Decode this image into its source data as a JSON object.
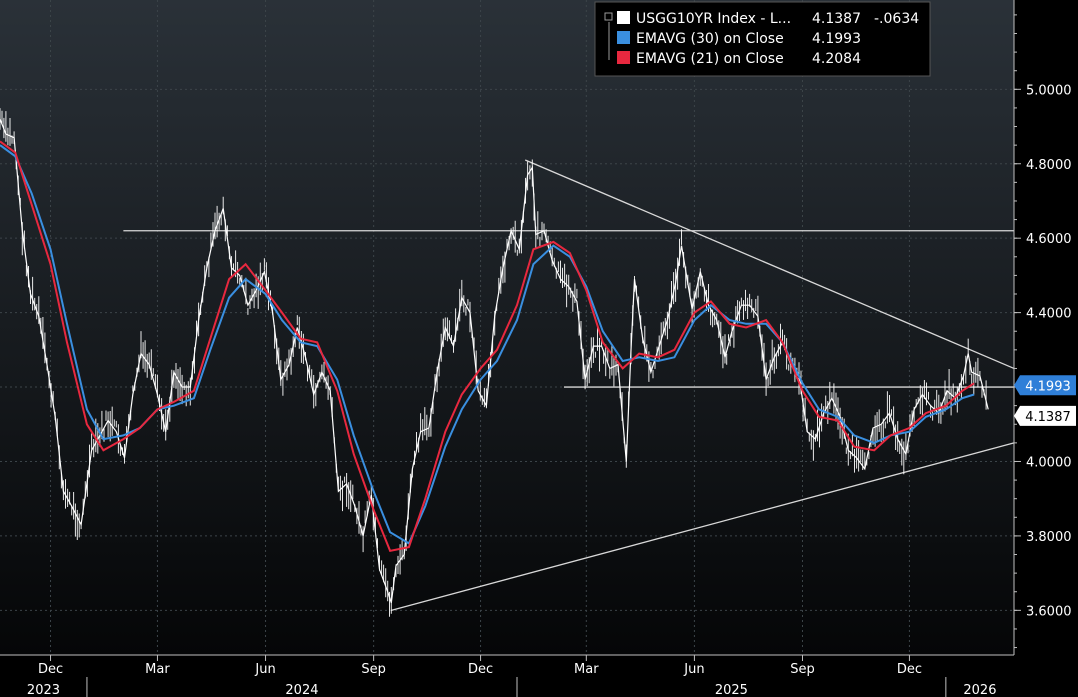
{
  "colors": {
    "background": "#000000",
    "gradient_top": "#2a3138",
    "gradient_bottom": "#050607",
    "price": "#ffffff",
    "ema30": "#3a8fe0",
    "ema21": "#e8283f",
    "trendline": "#d8d8d8",
    "axis": "#bfbfbf"
  },
  "legend": {
    "items": [
      {
        "label": "USGG10YR Index - L...",
        "value": "4.1387",
        "change": "-.0634",
        "color": "#ffffff",
        "icon": "white-square-icon"
      },
      {
        "label": "EMAVG (30)  on Close",
        "value": "4.1993",
        "change": "",
        "color": "#3a8fe0",
        "icon": "blue-square-icon"
      },
      {
        "label": "EMAVG (21)  on Close",
        "value": "4.2084",
        "change": "",
        "color": "#e8283f",
        "icon": "red-square-icon"
      }
    ]
  },
  "last_value_tags": [
    {
      "text": "4.1993",
      "value": 4.1993,
      "bg": "#2f7fd8",
      "fg": "#ffffff"
    },
    {
      "text": "4.1387",
      "value": 4.1387,
      "bg": "#ffffff",
      "fg": "#000000"
    }
  ],
  "chart_data": {
    "type": "line",
    "title": "",
    "xlabel": "",
    "ylabel": "",
    "x_range": [
      "2023-10-19",
      "2026-02-28"
    ],
    "ylim": [
      3.48,
      5.24
    ],
    "grid": true,
    "legend_position": "top-right",
    "y_ticks": [
      {
        "value": 3.6,
        "label": "3.6000"
      },
      {
        "value": 3.8,
        "label": "3.8000"
      },
      {
        "value": 4.0,
        "label": "4.0000"
      },
      {
        "value": 4.2,
        "label": "4.2000"
      },
      {
        "value": 4.4,
        "label": "4.4000"
      },
      {
        "value": 4.6,
        "label": "4.6000"
      },
      {
        "value": 4.8,
        "label": "4.8000"
      },
      {
        "value": 5.0,
        "label": "5.0000"
      }
    ],
    "x_ticks": [
      {
        "date": "2023-12-01",
        "label": "Dec"
      },
      {
        "date": "2024-03-01",
        "label": "Mar"
      },
      {
        "date": "2024-06-01",
        "label": "Jun"
      },
      {
        "date": "2024-09-01",
        "label": "Sep"
      },
      {
        "date": "2024-12-01",
        "label": "Dec"
      },
      {
        "date": "2025-03-01",
        "label": "Mar"
      },
      {
        "date": "2025-06-01",
        "label": "Jun"
      },
      {
        "date": "2025-09-01",
        "label": "Sep"
      },
      {
        "date": "2025-12-01",
        "label": "Dec"
      }
    ],
    "years": [
      {
        "label": "2023",
        "start": "2023-10-19",
        "end": "2024-01-01"
      },
      {
        "label": "2024",
        "start": "2024-01-01",
        "end": "2025-01-01"
      },
      {
        "label": "2025",
        "start": "2025-01-01",
        "end": "2026-01-01"
      },
      {
        "label": "2026",
        "start": "2026-01-01",
        "end": "2026-02-28"
      }
    ],
    "series": [
      {
        "name": "USGG10YR Index - L...",
        "color": "#ffffff",
        "x": [
          "2023-10-19",
          "2023-10-24",
          "2023-10-31",
          "2023-11-07",
          "2023-11-14",
          "2023-11-21",
          "2023-11-28",
          "2023-12-05",
          "2023-12-12",
          "2023-12-19",
          "2023-12-27",
          "2024-01-05",
          "2024-01-12",
          "2024-01-19",
          "2024-01-26",
          "2024-02-02",
          "2024-02-09",
          "2024-02-16",
          "2024-02-23",
          "2024-03-01",
          "2024-03-08",
          "2024-03-15",
          "2024-03-22",
          "2024-03-29",
          "2024-04-05",
          "2024-04-12",
          "2024-04-19",
          "2024-04-26",
          "2024-05-03",
          "2024-05-10",
          "2024-05-17",
          "2024-05-24",
          "2024-05-31",
          "2024-06-07",
          "2024-06-14",
          "2024-06-21",
          "2024-06-28",
          "2024-07-05",
          "2024-07-12",
          "2024-07-19",
          "2024-07-26",
          "2024-08-02",
          "2024-08-09",
          "2024-08-16",
          "2024-08-23",
          "2024-08-30",
          "2024-09-06",
          "2024-09-13",
          "2024-09-16",
          "2024-09-20",
          "2024-09-27",
          "2024-10-04",
          "2024-10-11",
          "2024-10-18",
          "2024-10-25",
          "2024-11-01",
          "2024-11-08",
          "2024-11-15",
          "2024-11-22",
          "2024-11-29",
          "2024-12-06",
          "2024-12-13",
          "2024-12-20",
          "2024-12-27",
          "2025-01-03",
          "2025-01-10",
          "2025-01-14",
          "2025-01-17",
          "2025-01-24",
          "2025-01-31",
          "2025-02-07",
          "2025-02-14",
          "2025-02-21",
          "2025-02-28",
          "2025-03-07",
          "2025-03-14",
          "2025-03-21",
          "2025-03-28",
          "2025-04-04",
          "2025-04-08",
          "2025-04-11",
          "2025-04-18",
          "2025-04-25",
          "2025-05-02",
          "2025-05-09",
          "2025-05-16",
          "2025-05-21",
          "2025-05-30",
          "2025-06-06",
          "2025-06-13",
          "2025-06-20",
          "2025-06-27",
          "2025-07-03",
          "2025-07-11",
          "2025-07-18",
          "2025-07-25",
          "2025-08-01",
          "2025-08-08",
          "2025-08-15",
          "2025-08-22",
          "2025-08-29",
          "2025-09-05",
          "2025-09-12",
          "2025-09-19",
          "2025-09-26",
          "2025-10-03",
          "2025-10-10",
          "2025-10-17",
          "2025-10-24",
          "2025-10-31",
          "2025-11-07",
          "2025-11-14",
          "2025-11-21",
          "2025-11-28",
          "2025-12-05",
          "2025-12-12",
          "2025-12-19",
          "2025-12-26",
          "2026-01-02",
          "2026-01-09",
          "2026-01-16",
          "2026-01-20",
          "2026-01-23",
          "2026-01-30",
          "2026-02-06"
        ],
        "y": [
          4.92,
          4.88,
          4.87,
          4.62,
          4.45,
          4.39,
          4.26,
          4.12,
          3.92,
          3.88,
          3.83,
          4.03,
          4.07,
          4.11,
          4.08,
          4.01,
          4.18,
          4.29,
          4.26,
          4.18,
          4.08,
          4.24,
          4.2,
          4.2,
          4.38,
          4.52,
          4.62,
          4.68,
          4.52,
          4.5,
          4.42,
          4.46,
          4.51,
          4.4,
          4.22,
          4.26,
          4.36,
          4.28,
          4.18,
          4.24,
          4.19,
          3.92,
          3.94,
          3.88,
          3.8,
          3.91,
          3.71,
          3.65,
          3.62,
          3.72,
          3.75,
          3.98,
          4.08,
          4.09,
          4.24,
          4.36,
          4.31,
          4.44,
          4.4,
          4.19,
          4.15,
          4.39,
          4.52,
          4.62,
          4.57,
          4.77,
          4.79,
          4.61,
          4.62,
          4.54,
          4.49,
          4.47,
          4.43,
          4.22,
          4.31,
          4.31,
          4.25,
          4.26,
          4.0,
          4.3,
          4.49,
          4.33,
          4.24,
          4.31,
          4.38,
          4.48,
          4.58,
          4.41,
          4.51,
          4.42,
          4.38,
          4.28,
          4.35,
          4.42,
          4.42,
          4.39,
          4.22,
          4.28,
          4.32,
          4.26,
          4.23,
          4.08,
          4.06,
          4.13,
          4.17,
          4.12,
          4.03,
          4.01,
          3.98,
          4.09,
          4.1,
          4.13,
          4.06,
          4.02,
          4.14,
          4.18,
          4.15,
          4.13,
          4.19,
          4.17,
          4.23,
          4.29,
          4.24,
          4.23,
          4.14
        ]
      },
      {
        "name": "EMAVG (30)  on Close",
        "color": "#3a8fe0",
        "x": [
          "2023-10-19",
          "2023-11-01",
          "2023-11-15",
          "2023-12-01",
          "2023-12-15",
          "2024-01-01",
          "2024-01-15",
          "2024-02-01",
          "2024-02-15",
          "2024-03-01",
          "2024-03-15",
          "2024-04-01",
          "2024-04-15",
          "2024-05-01",
          "2024-05-15",
          "2024-06-01",
          "2024-06-15",
          "2024-07-01",
          "2024-07-15",
          "2024-08-01",
          "2024-08-15",
          "2024-09-01",
          "2024-09-15",
          "2024-10-01",
          "2024-10-15",
          "2024-11-01",
          "2024-11-15",
          "2024-12-01",
          "2024-12-15",
          "2025-01-01",
          "2025-01-15",
          "2025-02-01",
          "2025-02-15",
          "2025-03-01",
          "2025-03-15",
          "2025-04-01",
          "2025-04-15",
          "2025-05-01",
          "2025-05-15",
          "2025-06-01",
          "2025-06-15",
          "2025-07-01",
          "2025-07-15",
          "2025-08-01",
          "2025-08-15",
          "2025-09-01",
          "2025-09-15",
          "2025-10-01",
          "2025-10-15",
          "2025-11-01",
          "2025-11-15",
          "2025-12-01",
          "2025-12-15",
          "2026-01-01",
          "2026-01-15",
          "2026-01-25"
        ],
        "y": [
          4.85,
          4.82,
          4.72,
          4.57,
          4.37,
          4.14,
          4.06,
          4.07,
          4.09,
          4.14,
          4.15,
          4.17,
          4.3,
          4.44,
          4.49,
          4.45,
          4.38,
          4.32,
          4.31,
          4.22,
          4.07,
          3.92,
          3.81,
          3.78,
          3.88,
          4.04,
          4.14,
          4.22,
          4.27,
          4.38,
          4.53,
          4.58,
          4.55,
          4.47,
          4.35,
          4.27,
          4.28,
          4.27,
          4.28,
          4.38,
          4.42,
          4.38,
          4.37,
          4.37,
          4.32,
          4.21,
          4.14,
          4.12,
          4.07,
          4.05,
          4.07,
          4.08,
          4.12,
          4.14,
          4.17,
          4.18
        ]
      },
      {
        "name": "EMAVG (21)  on Close",
        "color": "#e8283f",
        "x": [
          "2023-10-19",
          "2023-11-01",
          "2023-11-15",
          "2023-12-01",
          "2023-12-15",
          "2024-01-01",
          "2024-01-15",
          "2024-02-01",
          "2024-02-15",
          "2024-03-01",
          "2024-03-15",
          "2024-04-01",
          "2024-04-15",
          "2024-05-01",
          "2024-05-15",
          "2024-06-01",
          "2024-06-15",
          "2024-07-01",
          "2024-07-15",
          "2024-08-01",
          "2024-08-15",
          "2024-09-01",
          "2024-09-15",
          "2024-10-01",
          "2024-10-15",
          "2024-11-01",
          "2024-11-15",
          "2024-12-01",
          "2024-12-15",
          "2025-01-01",
          "2025-01-15",
          "2025-02-01",
          "2025-02-15",
          "2025-03-01",
          "2025-03-15",
          "2025-04-01",
          "2025-04-15",
          "2025-05-01",
          "2025-05-15",
          "2025-06-01",
          "2025-06-15",
          "2025-07-01",
          "2025-07-15",
          "2025-08-01",
          "2025-08-15",
          "2025-09-01",
          "2025-09-15",
          "2025-10-01",
          "2025-10-15",
          "2025-11-01",
          "2025-11-15",
          "2025-12-01",
          "2025-12-15",
          "2026-01-01",
          "2026-01-15",
          "2026-01-25"
        ],
        "y": [
          4.86,
          4.83,
          4.69,
          4.53,
          4.32,
          4.1,
          4.03,
          4.06,
          4.09,
          4.14,
          4.16,
          4.19,
          4.33,
          4.49,
          4.53,
          4.46,
          4.4,
          4.33,
          4.32,
          4.19,
          4.02,
          3.87,
          3.76,
          3.77,
          3.9,
          4.08,
          4.18,
          4.25,
          4.3,
          4.42,
          4.57,
          4.59,
          4.56,
          4.46,
          4.32,
          4.25,
          4.29,
          4.28,
          4.3,
          4.4,
          4.43,
          4.37,
          4.36,
          4.38,
          4.32,
          4.19,
          4.12,
          4.11,
          4.04,
          4.03,
          4.07,
          4.09,
          4.13,
          4.15,
          4.19,
          4.21
        ]
      }
    ],
    "trendlines": [
      {
        "kind": "resistance",
        "from": {
          "x": "2025-01-08",
          "y": 4.81
        },
        "to": {
          "x": "2026-02-28",
          "y": 4.25
        }
      },
      {
        "kind": "support",
        "from": {
          "x": "2024-09-16",
          "y": 3.6
        },
        "to": {
          "x": "2026-02-28",
          "y": 4.05
        }
      },
      {
        "kind": "horizontal",
        "from": {
          "x": "2024-02-01",
          "y": 4.62
        },
        "to": {
          "x": "2026-02-28",
          "y": 4.62
        }
      },
      {
        "kind": "horizontal",
        "from": {
          "x": "2025-02-10",
          "y": 4.2
        },
        "to": {
          "x": "2026-02-28",
          "y": 4.2
        }
      }
    ]
  }
}
